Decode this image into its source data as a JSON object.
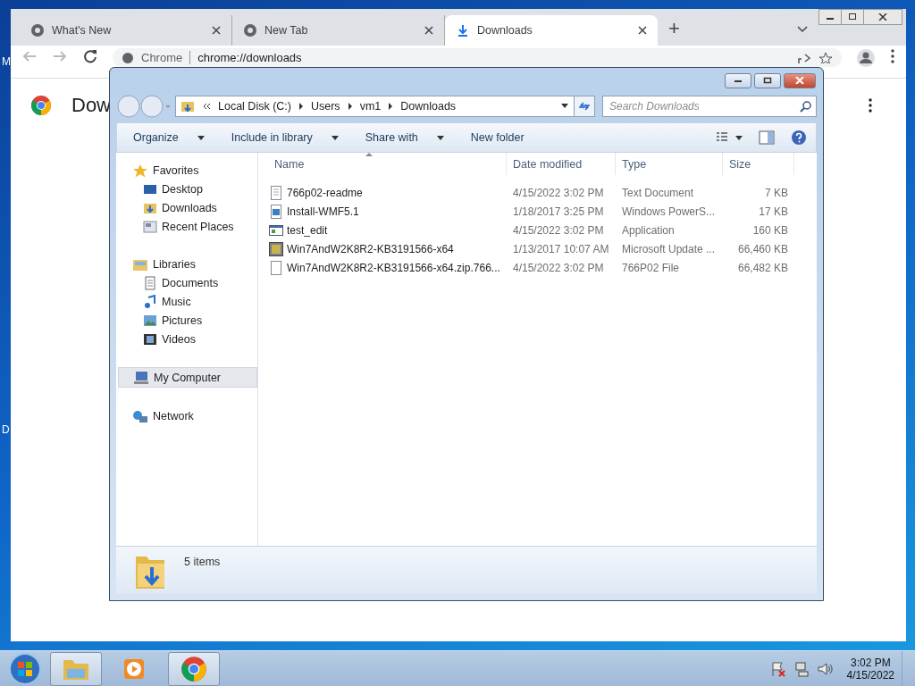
{
  "desktop": {
    "icon_labels": [
      "M",
      "D"
    ]
  },
  "chrome": {
    "tabs": [
      {
        "label": "What's New",
        "kind": "globe",
        "selected": false
      },
      {
        "label": "New Tab",
        "kind": "globe",
        "selected": false
      },
      {
        "label": "Downloads",
        "kind": "download",
        "selected": true
      }
    ],
    "new_tab": "+",
    "address": {
      "site": "Chrome",
      "url": "chrome://downloads"
    },
    "page_title": "Dow"
  },
  "explorer": {
    "breadcrumb": [
      "Local Disk (C:)",
      "Users",
      "vm1",
      "Downloads"
    ],
    "search": {
      "placeholder": "Search Downloads"
    },
    "commands": [
      {
        "label": "Organize",
        "dropdown": true
      },
      {
        "label": "Include in library",
        "dropdown": true
      },
      {
        "label": "Share with",
        "dropdown": true
      },
      {
        "label": "New folder",
        "dropdown": false
      }
    ],
    "nav": [
      {
        "label": "Favorites",
        "kind": "star",
        "selected": false,
        "children": [
          {
            "label": "Desktop",
            "kind": "desktop",
            "selected": false
          },
          {
            "label": "Downloads",
            "kind": "downloads",
            "selected": false
          },
          {
            "label": "Recent Places",
            "kind": "recent",
            "selected": false
          }
        ]
      },
      {
        "label": "Libraries",
        "kind": "library",
        "selected": false,
        "children": [
          {
            "label": "Documents",
            "kind": "doc",
            "selected": false
          },
          {
            "label": "Music",
            "kind": "music",
            "selected": false
          },
          {
            "label": "Pictures",
            "kind": "pictures",
            "selected": false
          },
          {
            "label": "Videos",
            "kind": "video",
            "selected": false
          }
        ]
      },
      {
        "label": "My Computer",
        "kind": "computer",
        "selected": true
      },
      {
        "label": "Network",
        "kind": "network",
        "selected": false
      }
    ],
    "columns": [
      {
        "label": "Name",
        "sorted": true
      },
      {
        "label": "Date modified",
        "sorted": false
      },
      {
        "label": "Type",
        "sorted": false
      },
      {
        "label": "Size",
        "sorted": false
      }
    ],
    "files": [
      {
        "name": "766p02-readme",
        "kind": "text",
        "date": "4/15/2022 3:02 PM",
        "type": "Text Document",
        "size": "7 KB"
      },
      {
        "name": "Install-WMF5.1",
        "kind": "script",
        "date": "1/18/2017 3:25 PM",
        "type": "Windows PowerS...",
        "size": "17 KB"
      },
      {
        "name": "test_edit",
        "kind": "app",
        "date": "4/15/2022 3:02 PM",
        "type": "Application",
        "size": "160 KB"
      },
      {
        "name": "Win7AndW2K8R2-KB3191566-x64",
        "kind": "update",
        "date": "1/13/2017 10:07 AM",
        "type": "Microsoft Update ...",
        "size": "66,460 KB"
      },
      {
        "name": "Win7AndW2K8R2-KB3191566-x64.zip.766...",
        "kind": "file",
        "date": "4/15/2022 3:02 PM",
        "type": "766P02 File",
        "size": "66,482 KB"
      }
    ],
    "status": "5 items"
  },
  "taskbar": {
    "items": [
      {
        "kind": "explorer",
        "active": true
      },
      {
        "kind": "media",
        "active": false
      },
      {
        "kind": "chrome",
        "active": true
      }
    ],
    "time": "3:02 PM",
    "date": "4/15/2022"
  }
}
